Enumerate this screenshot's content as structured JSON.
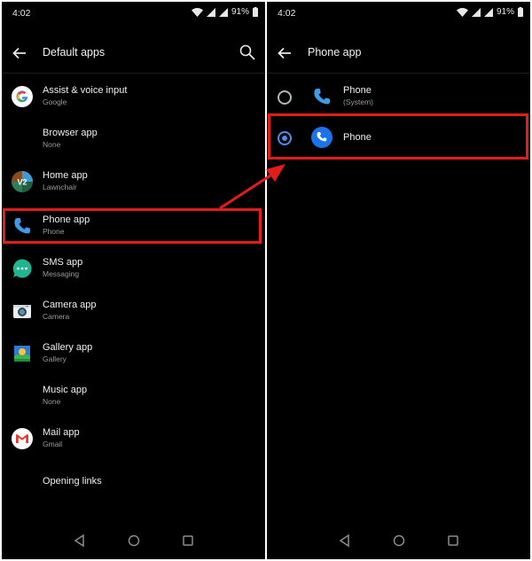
{
  "colors": {
    "accent": "#4f8cf0",
    "highlight": "#e21b1b",
    "background": "#000000"
  },
  "left": {
    "status": {
      "time": "4:02",
      "battery": "91%"
    },
    "header": {
      "title": "Default apps"
    },
    "items": [
      {
        "title": "Assist & voice input",
        "subtitle": "Google",
        "icon": "google-icon"
      },
      {
        "title": "Browser app",
        "subtitle": "None",
        "icon": ""
      },
      {
        "title": "Home app",
        "subtitle": "Lawnchair",
        "icon": "lawnchair-icon"
      },
      {
        "title": "Phone app",
        "subtitle": "Phone",
        "icon": "phone-icon"
      },
      {
        "title": "SMS app",
        "subtitle": "Messaging",
        "icon": "messaging-icon"
      },
      {
        "title": "Camera app",
        "subtitle": "Camera",
        "icon": "camera-icon"
      },
      {
        "title": "Gallery app",
        "subtitle": "Gallery",
        "icon": "gallery-icon"
      },
      {
        "title": "Music app",
        "subtitle": "None",
        "icon": ""
      },
      {
        "title": "Mail app",
        "subtitle": "Gmail",
        "icon": "gmail-icon"
      },
      {
        "title": "Opening links",
        "subtitle": "",
        "icon": ""
      }
    ],
    "lawnchair_badge": "V2"
  },
  "right": {
    "status": {
      "time": "4:02",
      "battery": "91%"
    },
    "header": {
      "title": "Phone app"
    },
    "options": [
      {
        "title": "Phone",
        "subtitle": "(System)",
        "selected": false,
        "icon": "phone-icon"
      },
      {
        "title": "Phone",
        "subtitle": "",
        "selected": true,
        "icon": "phone-circle-icon"
      }
    ]
  }
}
